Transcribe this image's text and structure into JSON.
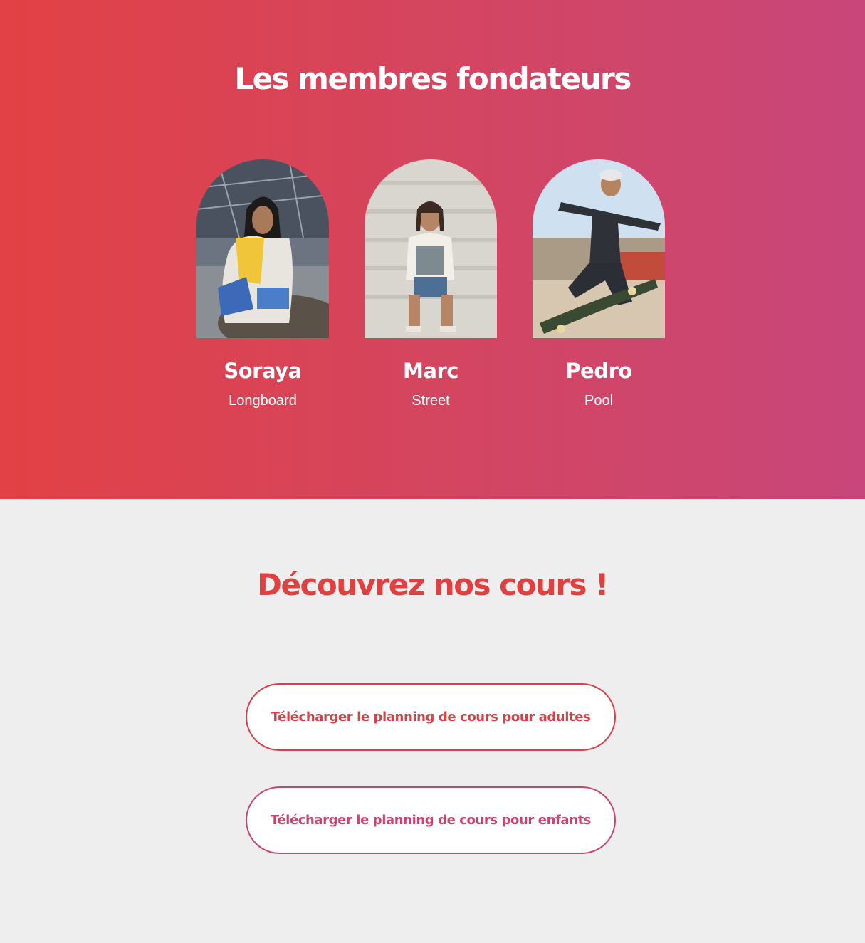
{
  "founders": {
    "title": "Les membres fondateurs",
    "members": [
      {
        "name": "Soraya",
        "discipline": "Longboard"
      },
      {
        "name": "Marc",
        "discipline": "Street"
      },
      {
        "name": "Pedro",
        "discipline": "Pool"
      }
    ]
  },
  "courses": {
    "title": "Découvrez nos cours !",
    "buttons": [
      {
        "label": "Télécharger le planning de cours pour adultes"
      },
      {
        "label": "Télécharger le planning de cours pour enfants"
      }
    ]
  },
  "colors": {
    "gradient_start": "#e24145",
    "gradient_end": "#c8467a",
    "accent_red": "#e0403f",
    "accent_pink": "#c8466e",
    "background": "#eeeeee"
  }
}
